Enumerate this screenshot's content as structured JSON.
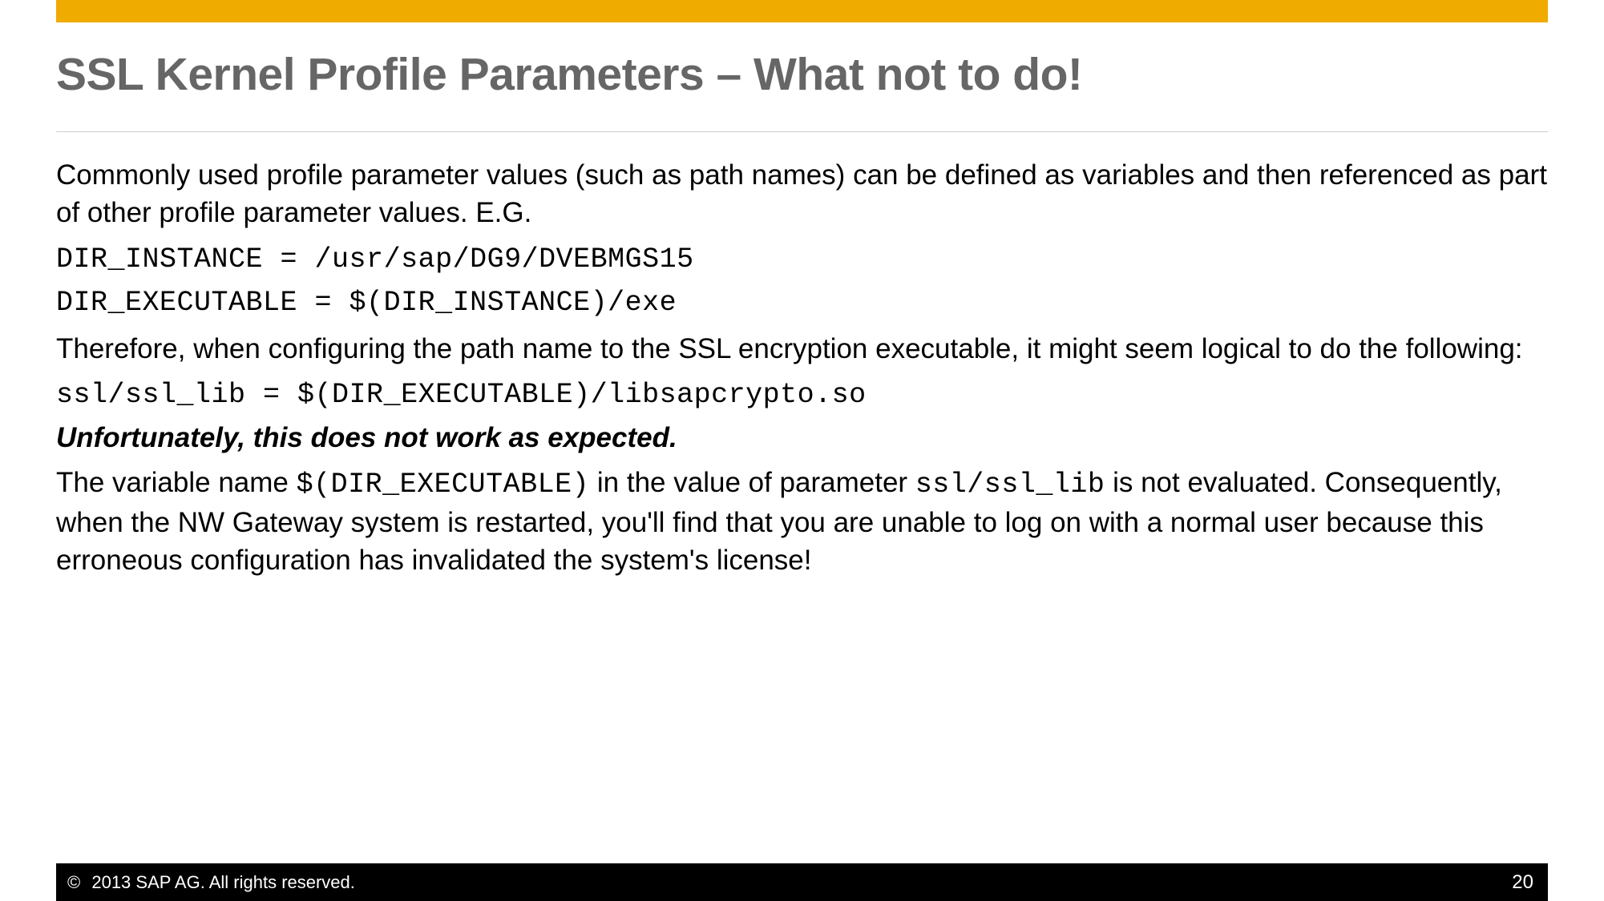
{
  "slide": {
    "title": "SSL Kernel Profile Parameters – What not to do!",
    "para1": "Commonly used profile parameter values (such as path names) can be defined as variables and then referenced as part of other profile parameter values.  E.G.",
    "code1": "DIR_INSTANCE = /usr/sap/DG9/DVEBMGS15",
    "code2": "DIR_EXECUTABLE = $(DIR_INSTANCE)/exe",
    "para2": "Therefore, when configuring the path name to the SSL encryption executable, it might seem logical to do the following:",
    "code3": "ssl/ssl_lib = $(DIR_EXECUTABLE)/libsapcrypto.so",
    "warning": "Unfortunately, this does not work as expected.",
    "para3_prefix": "The variable name ",
    "para3_code1": "$(DIR_EXECUTABLE)",
    "para3_mid": " in the value of parameter ",
    "para3_code2": "ssl/ssl_lib",
    "para3_suffix": " is not evaluated. Consequently, when the NW Gateway system is restarted, you'll find that you are unable to log on with a normal user because this erroneous configuration has invalidated the system's license!"
  },
  "footer": {
    "copyright": "2013 SAP AG. All rights reserved.",
    "page": "20"
  }
}
